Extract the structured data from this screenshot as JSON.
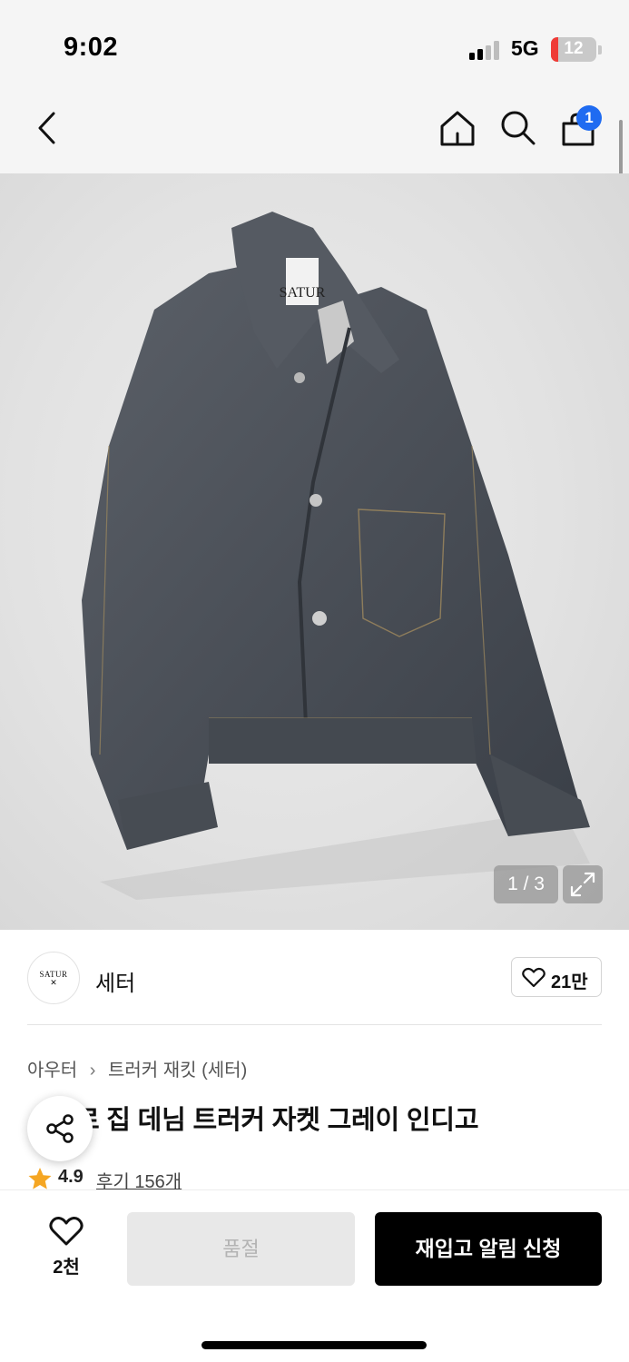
{
  "status_bar": {
    "time": "9:02",
    "network": "5G",
    "battery": "12",
    "battery_level": 0.12,
    "signal_bars": 2,
    "icons": [
      "signal-icon",
      "battery-icon"
    ]
  },
  "nav": {
    "icons": [
      "back-chevron-icon",
      "home-icon",
      "search-icon",
      "shopping-bag-icon"
    ],
    "cart_badge": "1"
  },
  "gallery": {
    "counter": "1 / 3",
    "icons": [
      "expand-icon"
    ],
    "image_label": "SATUR"
  },
  "brand": {
    "logo_text": "SATUR",
    "name": "세터",
    "like_count": "21만",
    "icons": [
      "heart-outline-icon"
    ]
  },
  "product": {
    "breadcrumb": [
      "아우터",
      "트러커 재킷 (세터)"
    ],
    "title_hidden": "플",
    "title_tail": "로 집 데님 트러커 자켓 그레이 인디고",
    "rating": "4.9",
    "review": "후기 156개",
    "icons": [
      "share-icon",
      "star-icon"
    ]
  },
  "bottom_bar": {
    "wish_count": "2천",
    "soldout_label": "품절",
    "restock_label": "재입고 알림 신청",
    "icons": [
      "heart-outline-icon"
    ]
  },
  "colors": {
    "accent_blue": "#1f6bf1",
    "star": "#f5a623",
    "primary_button": "#000000",
    "disabled_button": "#e8e8e8"
  }
}
